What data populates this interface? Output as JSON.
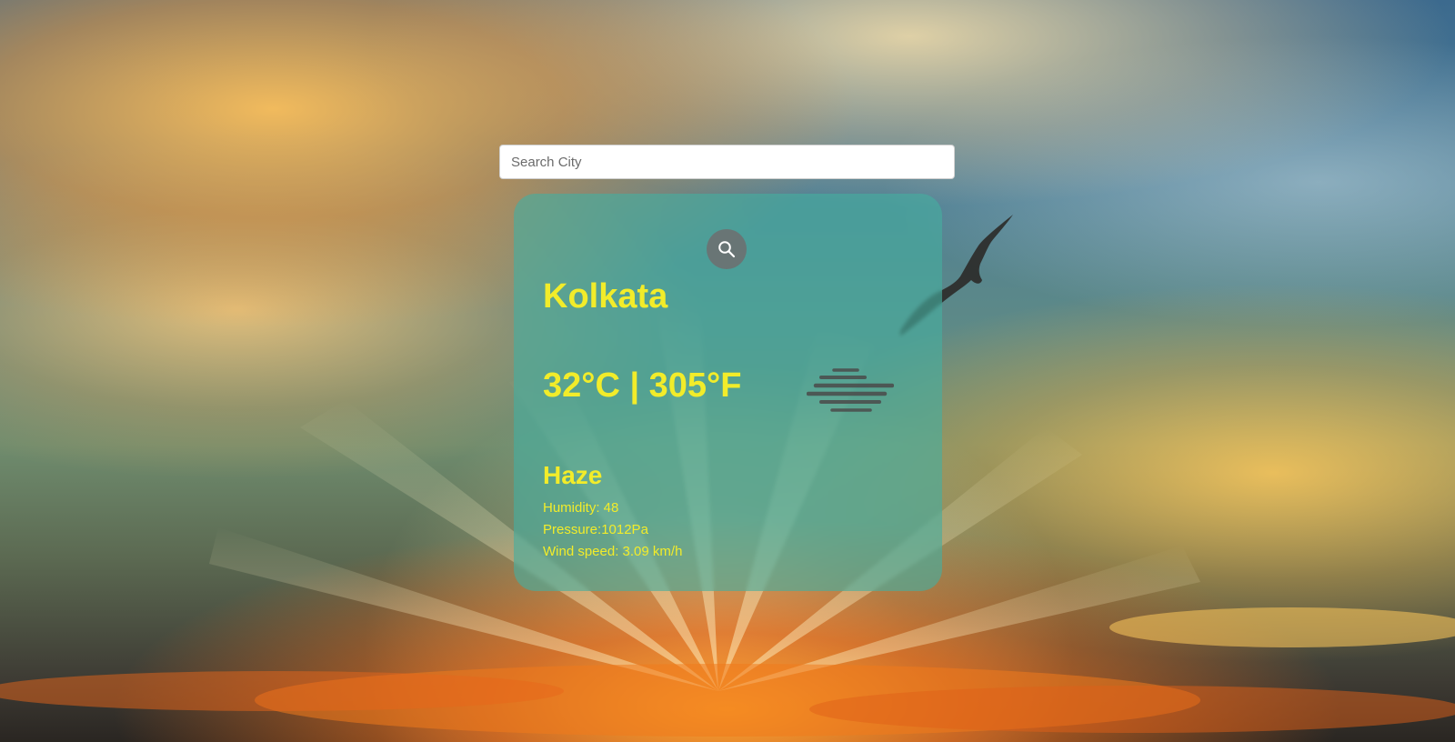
{
  "search": {
    "placeholder": "Search City",
    "value": ""
  },
  "weather": {
    "city": "Kolkata",
    "temperature": "32°C | 305°F",
    "condition": "Haze",
    "condition_icon": "haze-icon",
    "humidity": "Humidity: 48",
    "pressure": "Pressure:1012Pa",
    "wind_speed": "Wind speed: 3.09 km/h"
  },
  "colors": {
    "text_accent": "#f2ec2a",
    "card_bg": "rgba(70, 175, 160, 0.62)",
    "search_button_bg": "#6e6e6e"
  }
}
